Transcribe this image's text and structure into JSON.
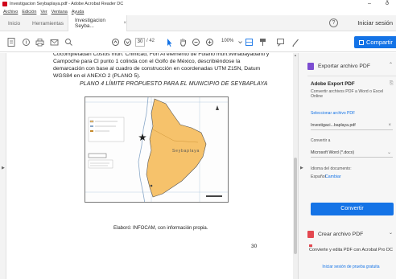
{
  "window": {
    "title": "Investigacion Seybaplaya.pdf - Adobe Acrobat Reader DC",
    "minimize": "–",
    "restore": "ð"
  },
  "menu": [
    "Archivo",
    "Edición",
    "Ver",
    "Ventana",
    "Ayuda"
  ],
  "tabs": {
    "home": "Inicio",
    "tools": "Herramientas",
    "document": "Investigacion Seyba...",
    "document_close": "×",
    "help": "?",
    "signin": "Iniciar sesión"
  },
  "toolbar": {
    "page_current": "30",
    "page_total": "/ 42",
    "zoom": "100%",
    "share_label": "Compartir"
  },
  "document": {
    "paragraph": "Cocompletadan Costos mun. Chinicad, Fon Al elemento de Fulano mun.Wihabayabanti y Campoche para Cl punto 1 colinda con el Golfo de México, describiéndose la demarcación con base al cuadro de construcción en coordenadas UTM Z15N, Datum WGS84 en el ANEXO 2 (PLANO 5).",
    "plano_title": "PLANO 4 LÍMITE PROPUESTO PARA EL MUNICIPIO DE SEYBAPLAYA",
    "map_label": "Seybaplaya",
    "caption": "Elaboró: INFOCAM, con información propia.",
    "page_number": "30"
  },
  "panel": {
    "export_header": "Exportar archivo PDF",
    "export_title": "Adobe Export PDF",
    "export_desc": "Convertir archivos PDF a Word o Excel Online",
    "select_label": "Seleccionar archivo PDF",
    "selected_file": "Investigaci...baplaya.pdf",
    "convert_to_label": "Convertir a",
    "convert_to_value": "Microsoft Word (*.docx)",
    "doc_language_label": "Idioma del documento:",
    "doc_language_value": "Español",
    "change_link": "Cambiar",
    "convert_button": "Convertir",
    "create_header": "Crear archivo PDF",
    "promo": "Convierte y edita PDF con Acrobat Pro DC",
    "trial_link": "Iniciar sesión de prueba gratuita"
  },
  "colors": {
    "accent": "#1473e6",
    "map_fill": "#f6c26b",
    "export_icon": "#7c4dd1",
    "create_icon": "#e34850"
  }
}
